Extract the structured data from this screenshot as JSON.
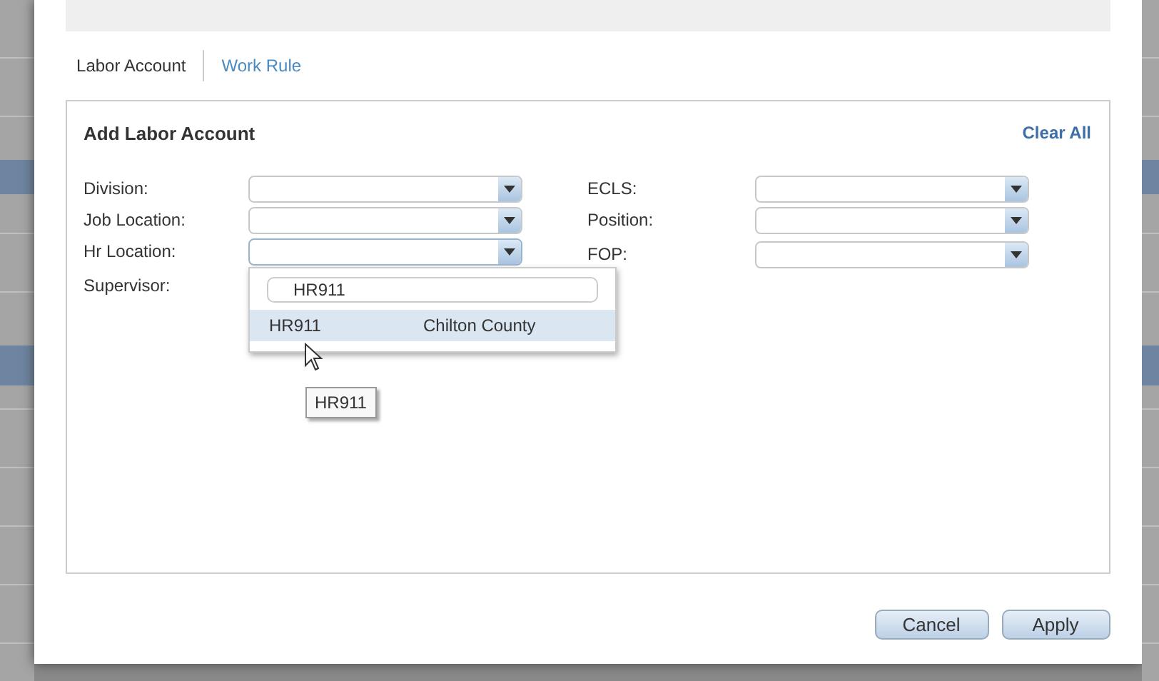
{
  "tabs": [
    {
      "label": "Labor Account",
      "selected": true
    },
    {
      "label": "Work Rule",
      "selected": false
    }
  ],
  "panel": {
    "title": "Add Labor Account",
    "clear_link": "Clear All",
    "fields_left": [
      {
        "label": "Division:"
      },
      {
        "label": "Job Location:"
      },
      {
        "label": "Hr Location:",
        "open": true
      },
      {
        "label": "Supervisor:"
      }
    ],
    "fields_right": [
      {
        "label": "ECLS:"
      },
      {
        "label": "Position:"
      },
      {
        "label": "FOP:"
      }
    ]
  },
  "dropdown": {
    "search": "HR911",
    "options": [
      {
        "code": "HR911",
        "name": "Chilton County",
        "selected": true
      }
    ]
  },
  "tooltip": "HR911",
  "buttons": [
    "Cancel",
    "Apply"
  ]
}
